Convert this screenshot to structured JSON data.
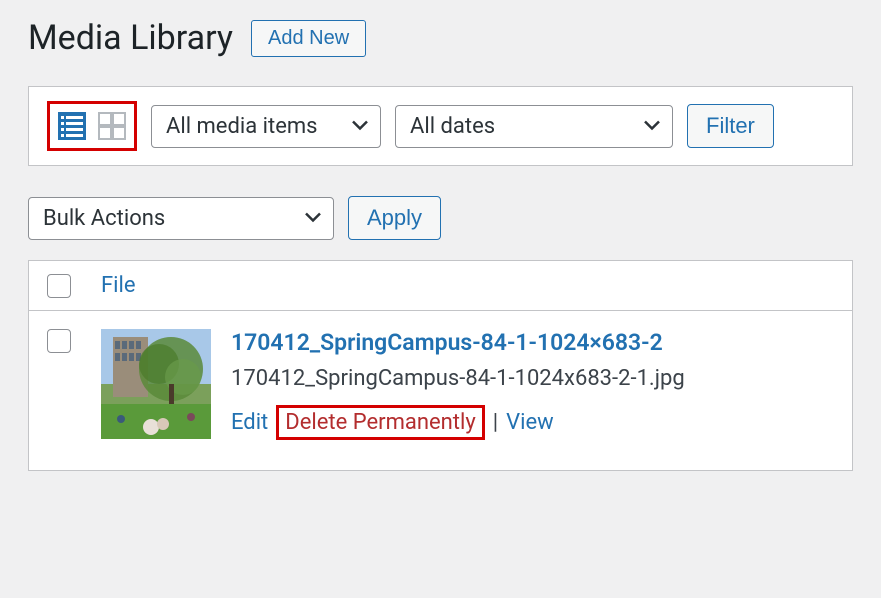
{
  "page": {
    "title": "Media Library",
    "add_new_label": "Add New"
  },
  "filters": {
    "media_type": "All media items",
    "dates": "All dates",
    "filter_button": "Filter"
  },
  "bulk": {
    "action_label": "Bulk Actions",
    "apply_label": "Apply"
  },
  "table": {
    "columns": {
      "file": "File"
    },
    "rows": [
      {
        "title": "170412_SpringCampus-84-1-1024×683-2",
        "filename": "170412_SpringCampus-84-1-1024x683-2-1.jpg",
        "actions": {
          "edit": "Edit",
          "delete": "Delete Permanently",
          "view": "View"
        }
      }
    ]
  }
}
